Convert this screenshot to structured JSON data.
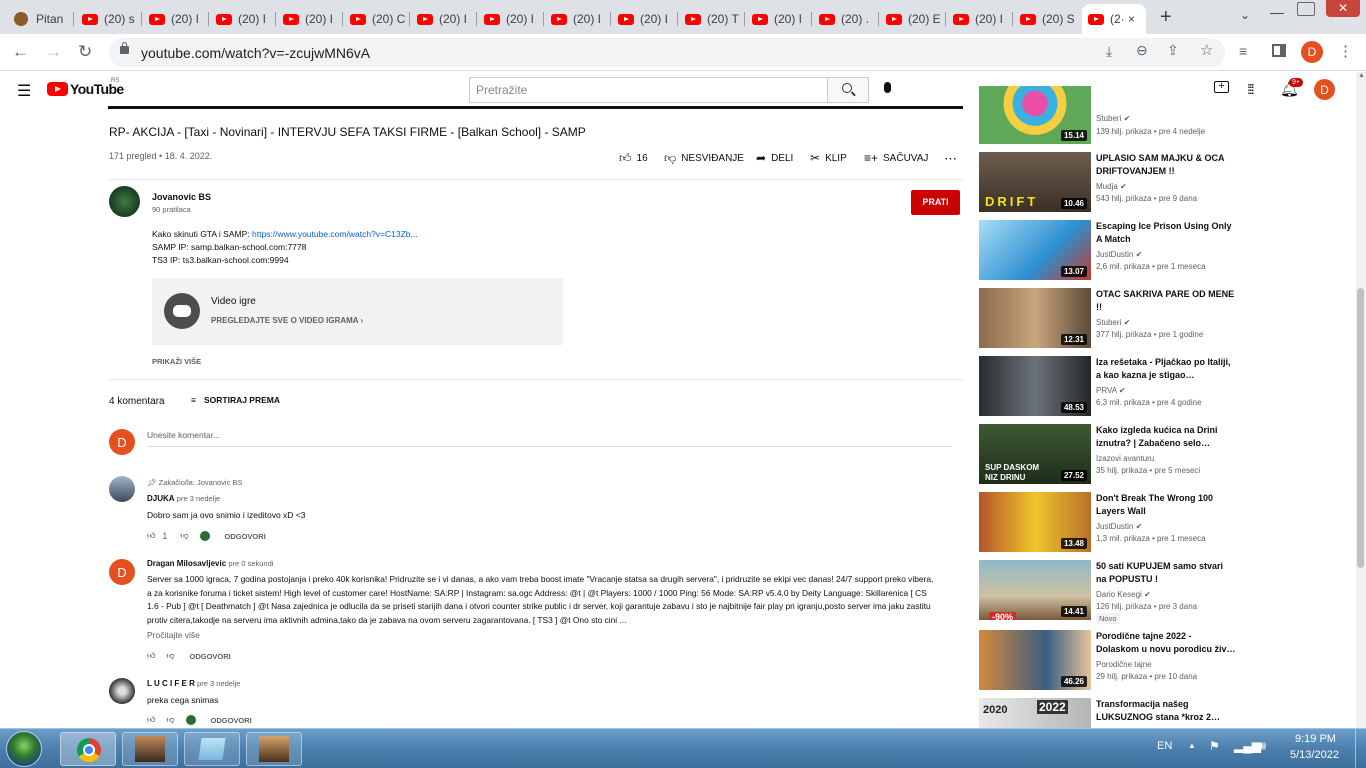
{
  "browser": {
    "tabs": [
      {
        "label": "Pitan"
      },
      {
        "label": "(20) s"
      },
      {
        "label": "(20) I"
      },
      {
        "label": "(20) I"
      },
      {
        "label": "(20) I"
      },
      {
        "label": "(20) C"
      },
      {
        "label": "(20) I"
      },
      {
        "label": "(20) I"
      },
      {
        "label": "(20) I"
      },
      {
        "label": "(20) I"
      },
      {
        "label": "(20) T"
      },
      {
        "label": "(20) I"
      },
      {
        "label": "(20) ."
      },
      {
        "label": "(20) E"
      },
      {
        "label": "(20) I"
      },
      {
        "label": "(20) S"
      },
      {
        "label": "(2· ×"
      }
    ],
    "url": "youtube.com/watch?v=-zcujwMN6vA",
    "profile_initial": "D"
  },
  "yt": {
    "logo_text": "YouTube",
    "region": "RS",
    "search_placeholder": "Pretražite",
    "notif_count": "9+",
    "user_initial": "D"
  },
  "video": {
    "title": "RP- AKCIJA - [Taxi - Novinari] - INTERVJU SEFA TAKSI FIRME - [Balkan School] - SAMP",
    "views_date": "171 pregled • 18. 4. 2022.",
    "likes": "16",
    "dislike_label": "NESVIĐANJE",
    "share_label": "DELI",
    "clip_label": "KLIP",
    "save_label": "SAČUVAJ",
    "channel": "Jovanovic BS",
    "subscribers": "90 pratilaca",
    "subscribe_label": "PRATI",
    "desc_line1_prefix": "Kako skinuti GTA i SAMP: ",
    "desc_link": "https://www.youtube.com/watch?v=C13Zb...",
    "desc_line2": "SAMP IP: samp.balkan-school.com:7778",
    "desc_line3": "TS3 IP: ts3.balkan-school.com:9994",
    "game_card_title": "Video igre",
    "game_card_link": "PREGLEDAJTE SVE O VIDEO IGRAMA",
    "show_more": "PRIKAŽI VIŠE"
  },
  "comments": {
    "count": "4 komentara",
    "sort_label": "SORTIRAJ PREMA",
    "input_placeholder": "Unesite komentar...",
    "reply_label": "ODGOVORI",
    "items": [
      {
        "pinned": "Zakačio/la: Jovanovic BS",
        "author": "DJUKA",
        "time": "pre 3 nedelje",
        "text": "Dobro sam ja ovo snimio i izeditovo xD <3",
        "likes": "1"
      },
      {
        "author": "Dragan Milosavljevic",
        "time": "pre 0 sekundi",
        "text": "Server sa 1000 igraca, 7 godina postojanja i preko 40k korisnika! Pridruzite se i vi danas, a ako vam treba boost imate \"Vracanje statsa sa drugih servera\", i pridruzite se ekipi vec danas! 24/7 support preko vibera, a za korisnike foruma i ticket sistem! High level of customer care! HostName: SA:RP | Instagram: sa.ogc Address: @t | @t Players: 1000 / 1000 Ping: 56 Mode: SA:RP v5.4.0 by Deity Language: Skillarenica [ CS 1.6 - Pub ] @t [ Deathmatch ] @t Nasa zajednica je odlucila da se priseti starijih dana i otvori counter strike public i dr server, koji garantuje zabavu i sto je najbitnije fair play pri igranju,posto server ima jaku zastitu protiv citera,takodje na serveru ima aktivnih admina,tako da je zabava na ovom serveru zagarantovana. [ TS3 ] @t Ono sto cini ...",
        "read_more": "Pročitajte više",
        "initial": "D"
      },
      {
        "author": "L U C I F E R",
        "time": "pre 3 nedelje",
        "text": "preka cega snimas"
      }
    ]
  },
  "recommended": [
    {
      "title": "",
      "channel": "Stuberi",
      "meta": "139 hilj. prikaza • pre 4 nedelje",
      "duration": "15.14",
      "verified": true
    },
    {
      "title": "UPLASIO SAM MAJKU & OCA DRIFTOVANJEM !!",
      "channel": "Mudja",
      "meta": "543 hilj. prikaza • pre 9 dana",
      "duration": "10.46",
      "verified": true
    },
    {
      "title": "Escaping Ice Prison Using Only A Match",
      "channel": "JustDustin",
      "meta": "2,6 mil. prikaza • pre 1 meseca",
      "duration": "13.07",
      "verified": true
    },
    {
      "title": "OTAC SAKRIVA PARE OD MENE !!",
      "channel": "Stuberi",
      "meta": "377 hilj. prikaza • pre 1 godine",
      "duration": "12.31",
      "verified": true
    },
    {
      "title": "Iza rešetaka - Pljačkao po Italiji, a kao kazna je stigao…",
      "channel": "PRVA",
      "meta": "6,3 mil. prikaza • pre 4 godine",
      "duration": "48.53",
      "verified": true
    },
    {
      "title": "Kako izgleda kućica na Drini iznutra? | Zabačeno selo…",
      "channel": "Izazovi avanturu",
      "meta": "35 hilj. prikaza • pre 5 meseci",
      "duration": "27.52",
      "verified": false
    },
    {
      "title": "Don't Break The Wrong 100 Layers Wall",
      "channel": "JustDustin",
      "meta": "1,3 mil. prikaza • pre 1 meseca",
      "duration": "13.48",
      "verified": true
    },
    {
      "title": "50 sati KUPUJEM samo stvari na POPUSTU !",
      "channel": "Dario Kesegi",
      "meta": "126 hilj. prikaza • pre 3 dana",
      "duration": "14.41",
      "verified": true,
      "badge": "Novo"
    },
    {
      "title": "Porodične tajne 2022 - Dolaskom u novu porodicu živ…",
      "channel": "Porodične tajne",
      "meta": "29 hilj. prikaza • pre 10 dana",
      "duration": "46.26",
      "verified": false
    },
    {
      "title": "Transformacija našeg LUKSUZNOG stana *kroz 2…",
      "channel": "",
      "meta": "",
      "duration": "",
      "verified": false
    }
  ],
  "thumb_texts": {
    "drift": "DRIFT",
    "sup1": "SUP DASKOM",
    "sup2": "NIZ DRINU",
    "pct": "-90%",
    "y1": "2020",
    "y2": "2022"
  },
  "taskbar": {
    "lang": "EN",
    "time": "9:19 PM",
    "date": "5/13/2022"
  },
  "colors": {
    "accent_red": "#cc0000",
    "avatar": "#e4501e",
    "link": "#065fd4"
  }
}
